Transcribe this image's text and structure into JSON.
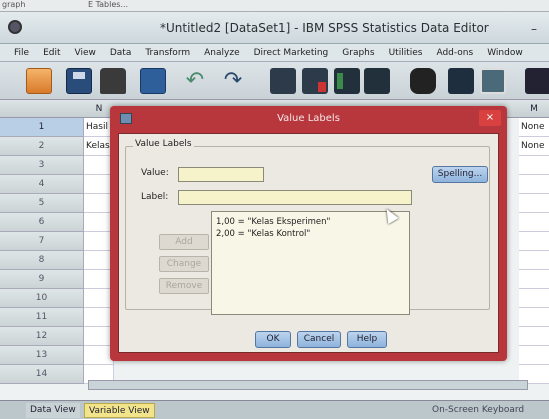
{
  "bg_window": {
    "tab1": "graph",
    "tab2": "E Tables..."
  },
  "app": {
    "title": "*Untitled2 [DataSet1] - IBM SPSS Statistics Data Editor",
    "minimize": "–"
  },
  "menu": [
    "File",
    "Edit",
    "View",
    "Data",
    "Transform",
    "Analyze",
    "Direct Marketing",
    "Graphs",
    "Utilities",
    "Add-ons",
    "Window"
  ],
  "toolbar": {
    "icons": [
      "open-folder-icon",
      "save-icon",
      "print-icon",
      "recall-dialog-icon",
      "undo-icon",
      "redo-icon",
      "goto-case-icon",
      "goto-variable-icon",
      "variables-icon",
      "find-icon",
      "binoculars-icon",
      "split-file-icon",
      "weight-cases-icon",
      "select-cases-icon"
    ]
  },
  "grid": {
    "col_header_name": "N",
    "col_header_right": "M",
    "rows": [
      {
        "num": "1",
        "name": "Hasil",
        "right": "None"
      },
      {
        "num": "2",
        "name": "Kelas",
        "right": "None"
      },
      {
        "num": "3",
        "name": "",
        "right": ""
      },
      {
        "num": "4",
        "name": "",
        "right": ""
      },
      {
        "num": "5",
        "name": "",
        "right": ""
      },
      {
        "num": "6",
        "name": "",
        "right": ""
      },
      {
        "num": "7",
        "name": "",
        "right": ""
      },
      {
        "num": "8",
        "name": "",
        "right": ""
      },
      {
        "num": "9",
        "name": "",
        "right": ""
      },
      {
        "num": "10",
        "name": "",
        "right": ""
      },
      {
        "num": "11",
        "name": "",
        "right": ""
      },
      {
        "num": "12",
        "name": "",
        "right": ""
      },
      {
        "num": "13",
        "name": "",
        "right": ""
      },
      {
        "num": "14",
        "name": "",
        "right": ""
      }
    ]
  },
  "tabs": {
    "data_view": "Data View",
    "variable_view": "Variable View",
    "osk": "On-Screen Keyboard"
  },
  "dialog": {
    "title": "Value Labels",
    "close": "×",
    "group_label": "Value Labels",
    "value_label": "Value:",
    "value_value": "",
    "label_label": "Label:",
    "label_value": "",
    "spelling": "Spelling...",
    "list": [
      "1,00 = \"Kelas Eksperimen\"",
      "2,00 = \"Kelas Kontrol\""
    ],
    "add": "Add",
    "change": "Change",
    "remove": "Remove",
    "ok": "OK",
    "cancel": "Cancel",
    "help": "Help"
  },
  "colors": {
    "dialog_frame": "#b8373d",
    "input_bg": "#f6f2c9",
    "button_blue": "#8eb3dc"
  }
}
